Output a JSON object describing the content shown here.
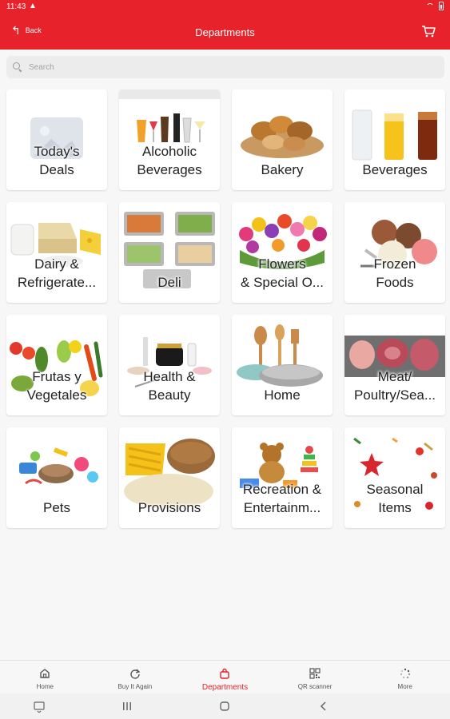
{
  "status_bar": {
    "time": "11:43"
  },
  "header": {
    "back_label": "Back",
    "title": "Departments"
  },
  "search": {
    "placeholder": "Search"
  },
  "departments": [
    {
      "name": "deals",
      "label": "Today's\nDeals"
    },
    {
      "name": "alcoholic-beverages",
      "label": "Alcoholic\nBeverages"
    },
    {
      "name": "bakery",
      "label": "Bakery"
    },
    {
      "name": "beverages",
      "label": "Beverages"
    },
    {
      "name": "dairy",
      "label": "Dairy &\nRefrigerate..."
    },
    {
      "name": "deli",
      "label": "Deli"
    },
    {
      "name": "flowers",
      "label": "Flowers\n& Special O..."
    },
    {
      "name": "frozen-foods",
      "label": "Frozen\nFoods"
    },
    {
      "name": "frutas",
      "label": "Frutas y\nVegetales"
    },
    {
      "name": "health-beauty",
      "label": "Health &\nBeauty"
    },
    {
      "name": "home",
      "label": "Home"
    },
    {
      "name": "meat",
      "label": "Meat/\nPoultry/Sea..."
    },
    {
      "name": "pets",
      "label": "Pets"
    },
    {
      "name": "provisions",
      "label": "Provisions"
    },
    {
      "name": "recreation",
      "label": "Recreation &\nEntertainm..."
    },
    {
      "name": "seasonal",
      "label": "Seasonal\nItems"
    }
  ],
  "bottom_nav": [
    {
      "label": "Home",
      "icon": "home-icon"
    },
    {
      "label": "Buy It Again",
      "icon": "refresh-icon"
    },
    {
      "label": "Departments",
      "icon": "bag-icon",
      "active": true
    },
    {
      "label": "QR scanner",
      "icon": "qr-icon"
    },
    {
      "label": "More",
      "icon": "more-icon"
    }
  ],
  "colors": {
    "brand": "#e8222b",
    "background": "#f7f7f7"
  }
}
